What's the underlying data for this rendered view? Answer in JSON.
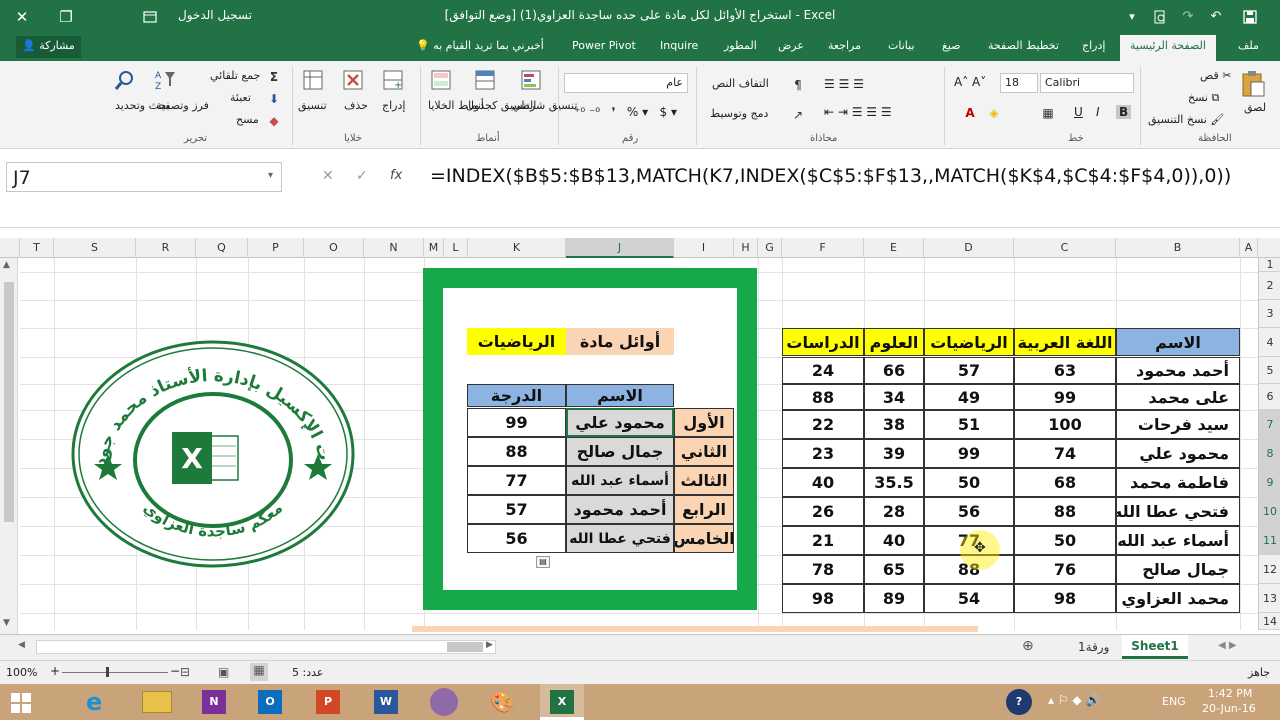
{
  "window": {
    "title": "استخراج الأوائل لكل مادة على حده ساجدة العزاوي(1)  [وضع التوافق] - Excel",
    "signin": "تسجيل الدخول",
    "controls": [
      "✕",
      "❐",
      "—"
    ]
  },
  "tabs": {
    "file": "ملف",
    "home": "الصفحة الرئيسية",
    "insert": "إدراج",
    "page_layout": "تخطيط الصفحة",
    "formulas": "صيغ",
    "data": "بيانات",
    "review": "مراجعة",
    "view": "عرض",
    "developer": "المطور",
    "inquire": "Inquire",
    "power_pivot": "Power Pivot",
    "tell_me": "أخبرني بما تريد القيام به",
    "share": "مشاركة"
  },
  "ribbon": {
    "clipboard": {
      "label": "الحافظة",
      "paste": "لصق",
      "cut": "قص",
      "copy": "نسخ",
      "format_painter": "نسخ التنسيق"
    },
    "font": {
      "label": "خط",
      "name": "Calibri",
      "size": "18",
      "bold": "B",
      "italic": "I",
      "underline": "U"
    },
    "alignment": {
      "label": "محاذاة",
      "wrap": "التفاف النص",
      "merge": "دمج وتوسيط"
    },
    "number": {
      "label": "رقم",
      "format": "عام"
    },
    "styles": {
      "label": "أنماط",
      "conditional": "تنسيق شرطي",
      "as_table": "التنسيق كجدول",
      "cell_styles": "أنماط الخلايا"
    },
    "cells": {
      "label": "خلايا",
      "insert": "إدراج",
      "delete": "حذف",
      "format": "تنسيق"
    },
    "editing": {
      "label": "تحرير",
      "autosum": "جمع تلقائي",
      "fill": "تعبئة",
      "clear": "مسح",
      "sort": "فرز وتصفية",
      "find": "بحث وتحديد"
    }
  },
  "formula_bar": {
    "name_box": "J7",
    "cancel": "✕",
    "enter": "✓",
    "fx": "fx",
    "formula": "=INDEX($B$5:$B$13,MATCH(K7,INDEX($C$5:$F$13,,MATCH($K$4,$C$4:$F$4,0)),0))"
  },
  "columns": [
    {
      "n": "T"
    },
    {
      "n": "S"
    },
    {
      "n": "R"
    },
    {
      "n": "Q"
    },
    {
      "n": "P"
    },
    {
      "n": "O"
    },
    {
      "n": "N"
    },
    {
      "n": "M"
    },
    {
      "n": "L"
    },
    {
      "n": "K"
    },
    {
      "n": "J"
    },
    {
      "n": "I"
    },
    {
      "n": "H"
    },
    {
      "n": "G"
    },
    {
      "n": "F"
    },
    {
      "n": "E"
    },
    {
      "n": "D"
    },
    {
      "n": "C"
    },
    {
      "n": "B"
    },
    {
      "n": "A"
    }
  ],
  "rows": [
    "1",
    "2",
    "3",
    "4",
    "5",
    "6",
    "7",
    "8",
    "9",
    "10",
    "11",
    "12",
    "13",
    "14"
  ],
  "main_table": {
    "headers": [
      "الاسم",
      "اللغة العربية",
      "الرياضيات",
      "العلوم",
      "الدراسات"
    ],
    "rows": [
      [
        "أحمد محمود",
        "63",
        "57",
        "66",
        "24"
      ],
      [
        "على محمد",
        "99",
        "49",
        "34",
        "88"
      ],
      [
        "سيد فرحات",
        "100",
        "51",
        "38",
        "22"
      ],
      [
        "محمود علي",
        "74",
        "99",
        "39",
        "23"
      ],
      [
        "فاطمة محمد",
        "68",
        "50",
        "35.5",
        "40"
      ],
      [
        "فتحي عطا الله",
        "88",
        "56",
        "28",
        "26"
      ],
      [
        "أسماء عبد الله",
        "50",
        "77",
        "40",
        "21"
      ],
      [
        "جمال صالح",
        "76",
        "88",
        "65",
        "78"
      ],
      [
        "محمد العزاوي",
        "98",
        "54",
        "89",
        "98"
      ]
    ]
  },
  "top_table": {
    "title_label": "أوائل مادة",
    "subject": "الرياضيات",
    "name_header": "الاسم",
    "score_header": "الدرجة",
    "ranks": [
      "الأول",
      "الثاني",
      "الثالث",
      "الرابع",
      "الخامس"
    ],
    "names": [
      "محمود علي",
      "جمال صالح",
      "أسماء عبد الله",
      "أحمد محمود",
      "فتحي عطا الله"
    ],
    "scores": [
      "99",
      "88",
      "77",
      "57",
      "56"
    ]
  },
  "logo": {
    "top_text": "دورات الإكسيل بإدارة الأستاذ محمد جودالله",
    "bottom_text": "معكم ساجدة العزاوي"
  },
  "sheet_tabs": {
    "active": "Sheet1",
    "other": "ورقة1"
  },
  "status": {
    "ready": "جاهز",
    "count": "عدد: 5",
    "zoom": "100%"
  },
  "taskbar": {
    "time": "1:42 PM",
    "date": "20-Jun-16",
    "lang": "ENG"
  },
  "colors": {
    "excel_green": "#217346",
    "frame_green": "#17a849",
    "yellow": "#ffff00",
    "peach": "#fbd4b4",
    "blue_header": "#8db3e2",
    "gray_cell": "#d9d9d9"
  }
}
